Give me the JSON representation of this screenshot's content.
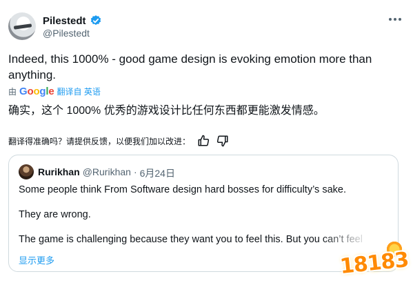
{
  "author": {
    "name": "Pilestedt",
    "handle": "@Pilestedt",
    "verified_icon": "verified-badge-icon"
  },
  "menu_icon": "more-dots-icon",
  "tweet": {
    "text": "Indeed, this 1000% - good game design is evoking emotion more than anything.",
    "translator_prefix": "由",
    "translator_brand": "Google",
    "translate_from": "翻译自 英语",
    "translated_text": "确实，这个 1000% 优秀的游戏设计比任何东西都更能激发情感。"
  },
  "feedback": {
    "prompt": "翻译得准确吗？请提供反馈，以便我们加以改进：",
    "thumbs_up_icon": "thumbs-up-icon",
    "thumbs_down_icon": "thumbs-down-icon"
  },
  "quote": {
    "name": "Rurikhan",
    "handle": "@Rurikhan",
    "separator": "·",
    "date": "6月24日",
    "lines": [
      "Some people think From Software design hard bosses for difficulty’s sake.",
      "They are wrong.",
      "The game is challenging because they want you to feel this. But you can’t feel"
    ],
    "show_more": "显示更多"
  },
  "watermark": {
    "text": "18183"
  },
  "colors": {
    "accent": "#1d9bf0",
    "text_primary": "#0f1419",
    "text_secondary": "#536471",
    "border": "#cfd9de"
  }
}
